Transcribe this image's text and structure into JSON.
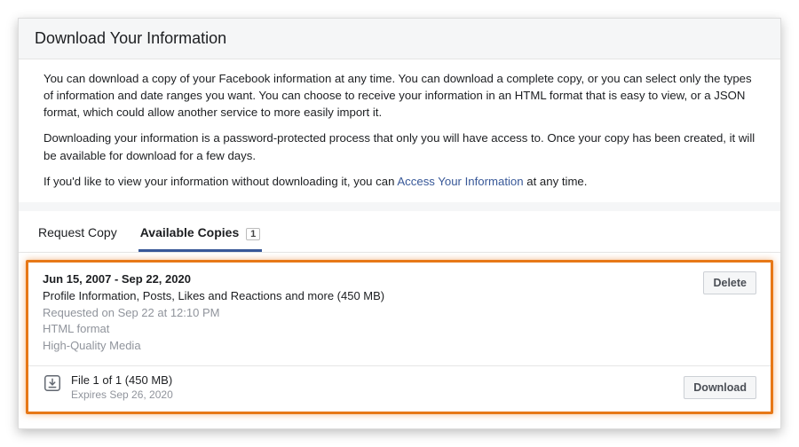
{
  "header": {
    "title": "Download Your Information"
  },
  "intro": {
    "p1": "You can download a copy of your Facebook information at any time. You can download a complete copy, or you can select only the types of information and date ranges you want. You can choose to receive your information in an HTML format that is easy to view, or a JSON format, which could allow another service to more easily import it.",
    "p2": "Downloading your information is a password-protected process that only you will have access to. Once your copy has been created, it will be available for download for a few days.",
    "p3_pre": "If you'd like to view your information without downloading it, you can ",
    "p3_link": "Access Your Information",
    "p3_post": " at any time."
  },
  "tabs": {
    "request": "Request Copy",
    "available": "Available Copies",
    "count": "1"
  },
  "copy": {
    "dates": "Jun 15, 2007 - Sep 22, 2020",
    "description": "Profile Information, Posts, Likes and Reactions and more (450 MB)",
    "requested": "Requested on Sep 22 at 12:10 PM",
    "format": "HTML format",
    "quality": "High-Quality Media",
    "delete": "Delete"
  },
  "file": {
    "label": "File 1 of 1 (450 MB)",
    "expires": "Expires Sep 26, 2020",
    "download": "Download"
  }
}
